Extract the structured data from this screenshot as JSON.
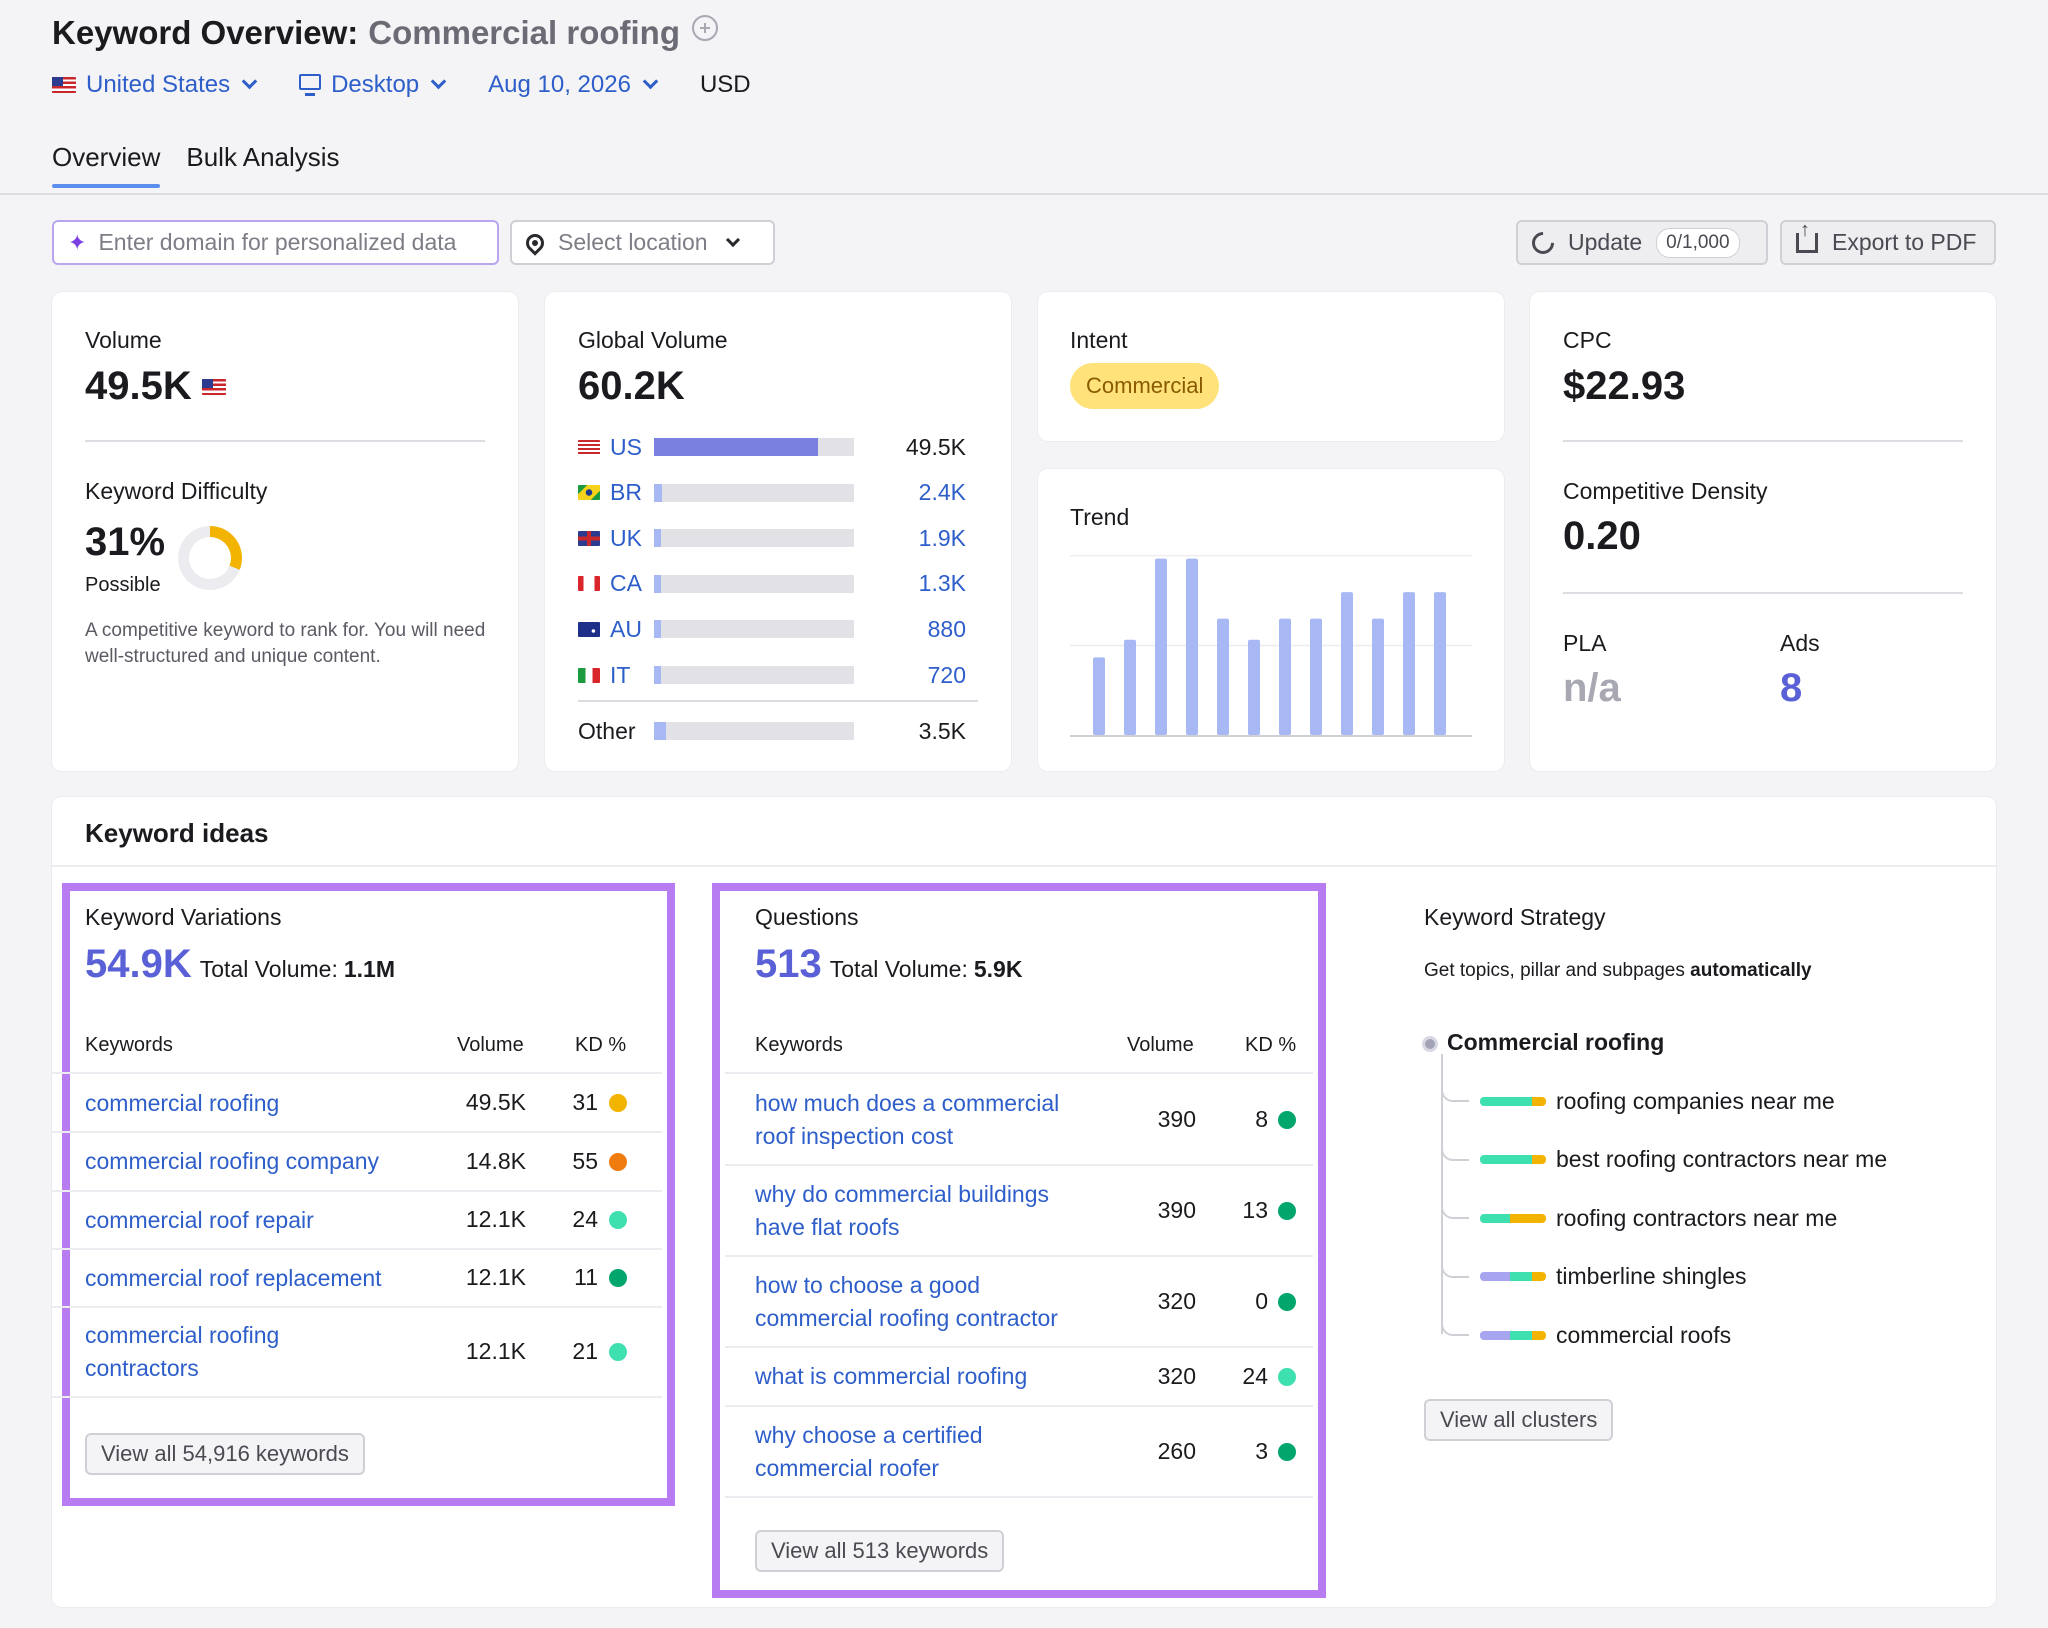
{
  "header": {
    "title": "Keyword Overview:",
    "keyword": "Commercial roofing",
    "country": "United States",
    "device": "Desktop",
    "date": "Aug 10, 2026",
    "currency": "USD"
  },
  "tabs": [
    "Overview",
    "Bulk Analysis"
  ],
  "toolbar": {
    "domain_placeholder": "Enter domain for personalized data",
    "location_placeholder": "Select location",
    "update_label": "Update",
    "update_counter": "0/1,000",
    "export_label": "Export to PDF"
  },
  "volume": {
    "label": "Volume",
    "value": "49.5K"
  },
  "difficulty": {
    "label": "Keyword Difficulty",
    "value": "31%",
    "percent": 31,
    "status": "Possible",
    "description": "A competitive keyword to rank for. You will need well-structured and unique content."
  },
  "global_volume": {
    "label": "Global Volume",
    "value": "60.2K",
    "countries": [
      {
        "code": "US",
        "value": "49.5K",
        "share": 0.82
      },
      {
        "code": "BR",
        "value": "2.4K",
        "share": 0.04
      },
      {
        "code": "UK",
        "value": "1.9K",
        "share": 0.03
      },
      {
        "code": "CA",
        "value": "1.3K",
        "share": 0.02
      },
      {
        "code": "AU",
        "value": "880",
        "share": 0.015
      },
      {
        "code": "IT",
        "value": "720",
        "share": 0.012
      }
    ],
    "other": {
      "label": "Other",
      "value": "3.5K",
      "share": 0.06
    }
  },
  "intent": {
    "label": "Intent",
    "value": "Commercial"
  },
  "trend": {
    "label": "Trend",
    "values": [
      0.44,
      0.54,
      1.0,
      1.0,
      0.66,
      0.54,
      0.66,
      0.66,
      0.81,
      0.66,
      0.81,
      0.81
    ]
  },
  "cpc": {
    "label": "CPC",
    "value": "$22.93"
  },
  "competitive_density": {
    "label": "Competitive Density",
    "value": "0.20"
  },
  "pla": {
    "label": "PLA",
    "value": "n/a"
  },
  "ads": {
    "label": "Ads",
    "value": "8"
  },
  "ideas": {
    "title": "Keyword ideas",
    "variations": {
      "title": "Keyword Variations",
      "count": "54.9K",
      "total_label": "Total Volume:",
      "total_value": "1.1M",
      "columns": [
        "Keywords",
        "Volume",
        "KD %"
      ],
      "rows": [
        {
          "keyword": "commercial roofing",
          "volume": "49.5K",
          "kd": "31",
          "color": "#f2b400"
        },
        {
          "keyword": "commercial roofing company",
          "volume": "14.8K",
          "kd": "55",
          "color": "#f07c10"
        },
        {
          "keyword": "commercial roof repair",
          "volume": "12.1K",
          "kd": "24",
          "color": "#3ee0b0"
        },
        {
          "keyword": "commercial roof replacement",
          "volume": "12.1K",
          "kd": "11",
          "color": "#00a66b"
        },
        {
          "keyword": "commercial roofing contractors",
          "volume": "12.1K",
          "kd": "21",
          "color": "#3ee0b0"
        }
      ],
      "view_all": "View all 54,916 keywords"
    },
    "questions": {
      "title": "Questions",
      "count": "513",
      "total_label": "Total Volume:",
      "total_value": "5.9K",
      "columns": [
        "Keywords",
        "Volume",
        "KD %"
      ],
      "rows": [
        {
          "keyword": "how much does a commercial roof inspection cost",
          "volume": "390",
          "kd": "8",
          "color": "#00a66b"
        },
        {
          "keyword": "why do commercial buildings have flat roofs",
          "volume": "390",
          "kd": "13",
          "color": "#00a66b"
        },
        {
          "keyword": "how to choose a good commercial roofing contractor",
          "volume": "320",
          "kd": "0",
          "color": "#00a66b"
        },
        {
          "keyword": "what is commercial roofing",
          "volume": "320",
          "kd": "24",
          "color": "#3ee0b0"
        },
        {
          "keyword": "why choose a certified commercial roofer",
          "volume": "260",
          "kd": "3",
          "color": "#00a66b"
        }
      ],
      "view_all": "View all 513 keywords"
    },
    "strategy": {
      "title": "Keyword Strategy",
      "subtitle": "Get topics, pillar and subpages",
      "subtitle_bold": "automatically",
      "root": "Commercial roofing",
      "items": [
        {
          "label": "roofing companies near me",
          "segments": [
            "#3ee0b0",
            "#3ee0b0",
            "#f2b400"
          ]
        },
        {
          "label": "best roofing contractors near me",
          "segments": [
            "#3ee0b0",
            "#3ee0b0",
            "#f2b400"
          ]
        },
        {
          "label": "roofing contractors near me",
          "segments": [
            "#3ee0b0",
            "#f2b400",
            "#f2b400"
          ]
        },
        {
          "label": "timberline shingles",
          "segments": [
            "#a7a4f0",
            "#3ee0b0",
            "#f2b400"
          ]
        },
        {
          "label": "commercial roofs",
          "segments": [
            "#a7a4f0",
            "#3ee0b0",
            "#f2b400"
          ]
        }
      ],
      "view_all": "View all clusters"
    }
  }
}
